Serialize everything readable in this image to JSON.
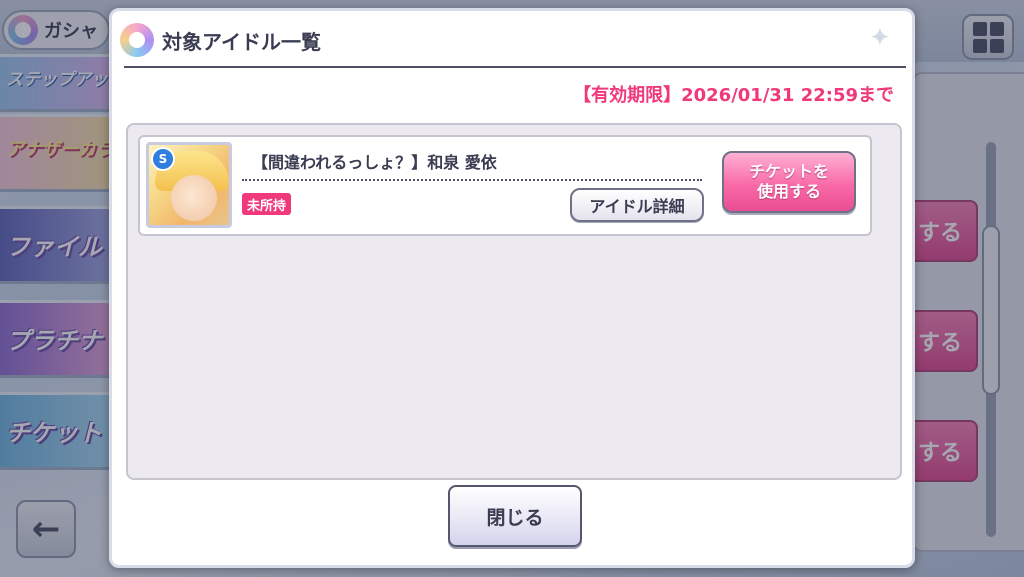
{
  "background": {
    "title": "ガシャ",
    "banners": [
      "ステップアップ B Side",
      "アナザーカラー コスチューム",
      "ファイル",
      "プラチナ",
      "チケット"
    ],
    "right_button_label": "する"
  },
  "dialog": {
    "title": "対象アイドル一覧",
    "expiry_text": "【有効期限】2026/01/31 22:59まで",
    "idols": [
      {
        "name": "【間違われるっしょ？】和泉 愛依",
        "rarity_badge": "S",
        "owned_status": "未所持",
        "detail_label": "アイドル詳細",
        "use_ticket_line1": "チケットを",
        "use_ticket_line2": "使用する"
      }
    ],
    "close_label": "閉じる"
  },
  "colors": {
    "accent_pink": "#f0397a",
    "button_pink": "#f96aa8",
    "text_dark": "#3a3d52"
  }
}
